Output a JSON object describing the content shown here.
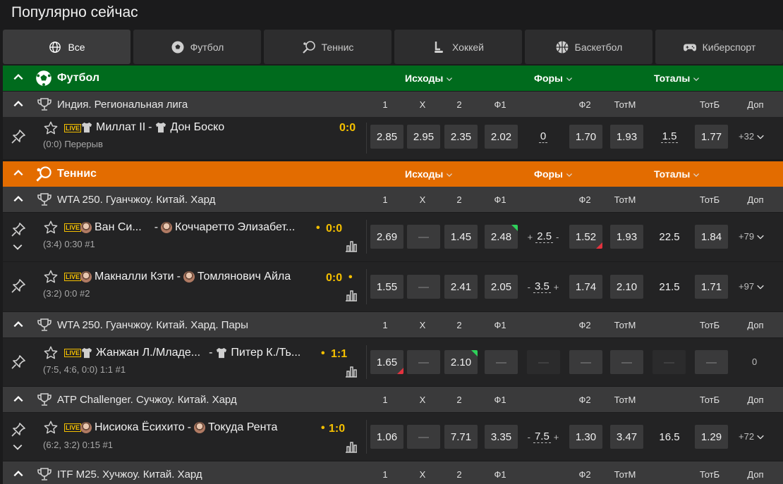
{
  "page_title": "Популярно сейчас",
  "tabs": [
    {
      "label": "Все",
      "icon": "globe-icon",
      "active": true
    },
    {
      "label": "Футбол",
      "icon": "soccer-ball-icon",
      "active": false
    },
    {
      "label": "Теннис",
      "icon": "tennis-racket-icon",
      "active": false
    },
    {
      "label": "Хоккей",
      "icon": "hockey-stick-icon",
      "active": false
    },
    {
      "label": "Баскетбол",
      "icon": "basketball-icon",
      "active": false
    },
    {
      "label": "Киберспорт",
      "icon": "gamepad-icon",
      "active": false
    }
  ],
  "markets": {
    "outcomes": "Исходы",
    "handicaps": "Форы",
    "totals": "Тоталы"
  },
  "columns": [
    "1",
    "X",
    "2",
    "Ф1",
    "Ф2",
    "ТотМ",
    "ТотБ",
    "Доп"
  ],
  "colors": {
    "football": "#006b1d",
    "tennis": "#e36c00",
    "score": "#f5c000",
    "up": "#2ed15a",
    "down": "#e2323e"
  },
  "sections": [
    {
      "sport": "Футбол",
      "leagues": [
        {
          "name": "Индия. Региональная лига",
          "matches": [
            {
              "team1": "Миллат II",
              "team2": "Дон Боско",
              "score": "0:0",
              "info": "(0:0) Перерыв",
              "odds": {
                "w1": "2.85",
                "x": "2.95",
                "w2": "2.35",
                "f1": "2.02",
                "hcp": "0",
                "f2": "1.70",
                "totm": "1.93",
                "total": "1.5",
                "totb": "1.77"
              },
              "more": "+32"
            }
          ]
        }
      ]
    },
    {
      "sport": "Теннис",
      "leagues": [
        {
          "name": "WTA 250. Гуанчжоу. Китай. Хард",
          "matches": [
            {
              "team1": "Ван Си...",
              "team2": "Коччаретто Элизабет...",
              "score": "0:0",
              "info": "(3:4) 0:30 #1",
              "odds": {
                "w1": "2.69",
                "x": "—",
                "w2": "1.45",
                "f1": "2.48",
                "hcp_pre": "+",
                "hcp": "2.5",
                "hcp_post": "-",
                "f2": "1.52",
                "totm": "1.93",
                "total": "22.5",
                "totb": "1.84"
              },
              "more": "+79"
            },
            {
              "team1": "Макналли Кэти",
              "team2": "Томлянович Айла",
              "score": "0:0",
              "info": "(3:2) 0:0 #2",
              "odds": {
                "w1": "1.55",
                "x": "—",
                "w2": "2.41",
                "f1": "2.05",
                "hcp_pre": "-",
                "hcp": "3.5",
                "hcp_post": "+",
                "f2": "1.74",
                "totm": "2.10",
                "total": "21.5",
                "totb": "1.71"
              },
              "more": "+97"
            }
          ]
        },
        {
          "name": "WTA 250. Гуанчжоу. Китай. Хард. Пары",
          "matches": [
            {
              "team1": "Жанжан Л./Младе...",
              "team2": "Питер К./Ть...",
              "score": "1:1",
              "info": "(7:5, 4:6, 0:0) 1:1 #1",
              "odds": {
                "w1": "1.65",
                "x": "—",
                "w2": "2.10",
                "f1": "—",
                "hcp": "—",
                "f2": "—",
                "totm": "—",
                "total": "—",
                "totb": "—"
              },
              "more": "0"
            }
          ]
        },
        {
          "name": "ATP Challenger. Сучжоу. Китай. Хард",
          "matches": [
            {
              "team1": "Нисиока Ёсихито",
              "team2": "Токуда Рента",
              "score": "1:0",
              "info": "(6:2, 3:2) 0:15 #1",
              "odds": {
                "w1": "1.06",
                "x": "—",
                "w2": "7.71",
                "f1": "3.35",
                "hcp_pre": "-",
                "hcp": "7.5",
                "hcp_post": "+",
                "f2": "1.30",
                "totm": "3.47",
                "total": "16.5",
                "totb": "1.29"
              },
              "more": "+72"
            }
          ]
        },
        {
          "name": "ITF M25. Хучжоу. Китай. Хард",
          "matches": []
        }
      ]
    }
  ],
  "live_badge": "LIVE",
  "dash": "-"
}
